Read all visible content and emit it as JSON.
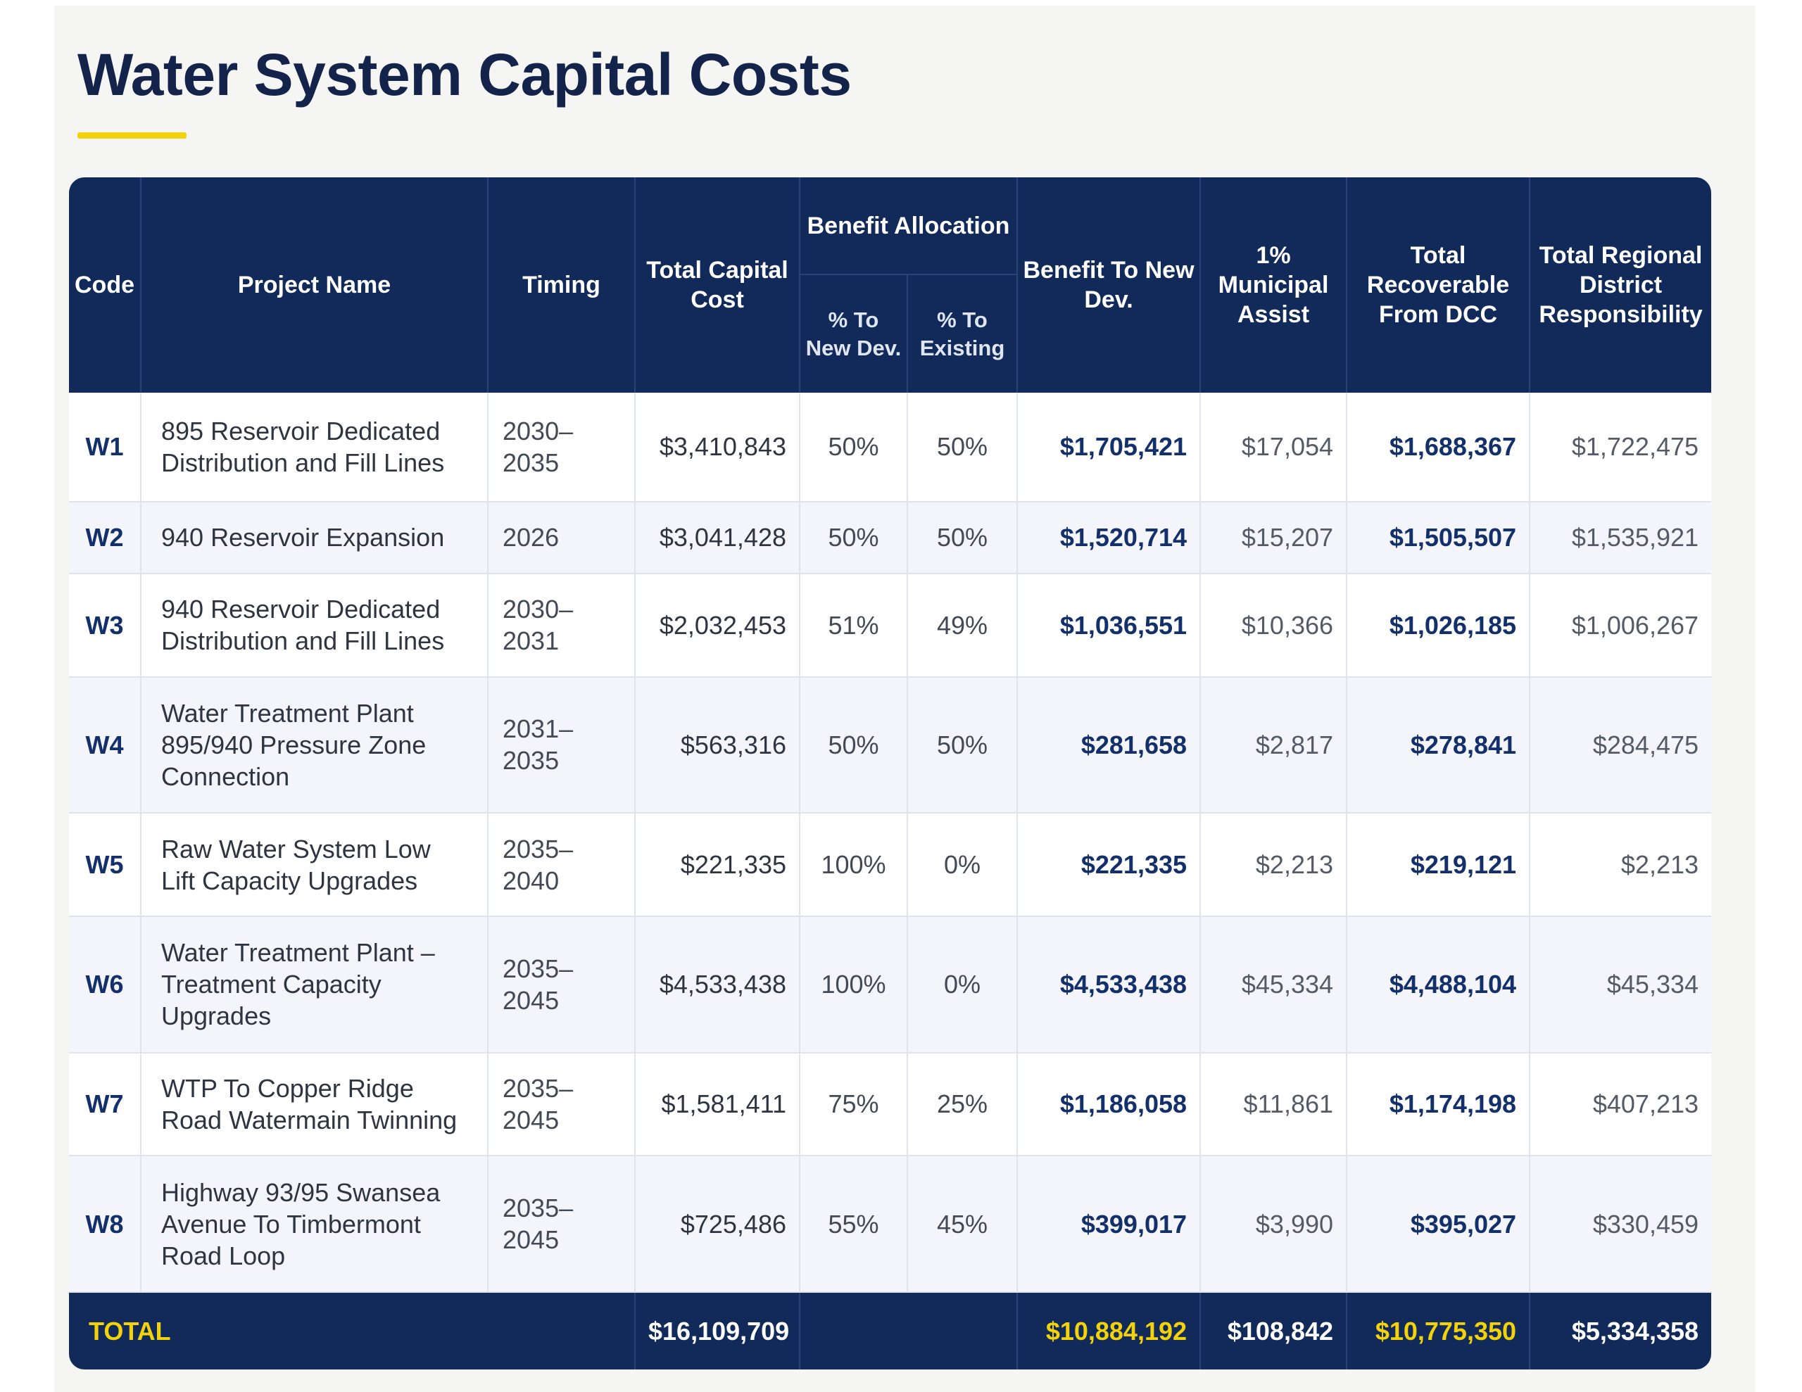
{
  "title": "Water System Capital Costs",
  "colors": {
    "navy": "#112a5a",
    "accent_yellow": "#f2d20b",
    "row_alt": "#f3f5fa"
  },
  "headers": {
    "code": "Code",
    "project_name": "Project Name",
    "timing": "Timing",
    "total_capital_cost": "Total Capital Cost",
    "benefit_allocation": "Benefit Allocation",
    "pct_new_dev": "% To New Dev.",
    "pct_existing": "% To Existing",
    "benefit_new_dev": "Benefit To New Dev.",
    "municipal_assist": "1% Municipal Assist",
    "recoverable_dcc": "Total Recoverable From DCC",
    "regional_responsibility": "Total Regional District Responsibility"
  },
  "rows": [
    {
      "code": "W1",
      "name": "895 Reservoir Dedicated Distribution and Fill Lines",
      "timing": "2030–2035",
      "capital": "$3,410,843",
      "new_pct": "50%",
      "existing_pct": "50%",
      "benefit": "$1,705,421",
      "assist": "$17,054",
      "recoverable": "$1,688,367",
      "regional": "$1,722,475"
    },
    {
      "code": "W2",
      "name": "940 Reservoir Expansion",
      "timing": "2026",
      "capital": "$3,041,428",
      "new_pct": "50%",
      "existing_pct": "50%",
      "benefit": "$1,520,714",
      "assist": "$15,207",
      "recoverable": "$1,505,507",
      "regional": "$1,535,921"
    },
    {
      "code": "W3",
      "name": "940 Reservoir Dedicated Distribution and Fill Lines",
      "timing": "2030–2031",
      "capital": "$2,032,453",
      "new_pct": "51%",
      "existing_pct": "49%",
      "benefit": "$1,036,551",
      "assist": "$10,366",
      "recoverable": "$1,026,185",
      "regional": "$1,006,267"
    },
    {
      "code": "W4",
      "name": "Water Treatment Plant 895/940 Pressure Zone Connection",
      "timing": "2031–2035",
      "capital": "$563,316",
      "new_pct": "50%",
      "existing_pct": "50%",
      "benefit": "$281,658",
      "assist": "$2,817",
      "recoverable": "$278,841",
      "regional": "$284,475"
    },
    {
      "code": "W5",
      "name": "Raw Water System Low Lift Capacity Upgrades",
      "timing": "2035–2040",
      "capital": "$221,335",
      "new_pct": "100%",
      "existing_pct": "0%",
      "benefit": "$221,335",
      "assist": "$2,213",
      "recoverable": "$219,121",
      "regional": "$2,213"
    },
    {
      "code": "W6",
      "name": "Water Treatment Plant – Treatment Capacity Upgrades",
      "timing": "2035–2045",
      "capital": "$4,533,438",
      "new_pct": "100%",
      "existing_pct": "0%",
      "benefit": "$4,533,438",
      "assist": "$45,334",
      "recoverable": "$4,488,104",
      "regional": "$45,334"
    },
    {
      "code": "W7",
      "name": "WTP To Copper Ridge Road Watermain Twinning",
      "timing": "2035–2045",
      "capital": "$1,581,411",
      "new_pct": "75%",
      "existing_pct": "25%",
      "benefit": "$1,186,058",
      "assist": "$11,861",
      "recoverable": "$1,174,198",
      "regional": "$407,213"
    },
    {
      "code": "W8",
      "name": "Highway 93/95 Swansea Avenue To Timbermont Road Loop",
      "timing": "2035–2045",
      "capital": "$725,486",
      "new_pct": "55%",
      "existing_pct": "45%",
      "benefit": "$399,017",
      "assist": "$3,990",
      "recoverable": "$395,027",
      "regional": "$330,459"
    }
  ],
  "total": {
    "label": "TOTAL",
    "capital": "$16,109,709",
    "benefit": "$10,884,192",
    "assist": "$108,842",
    "recoverable": "$10,775,350",
    "regional": "$5,334,358"
  }
}
